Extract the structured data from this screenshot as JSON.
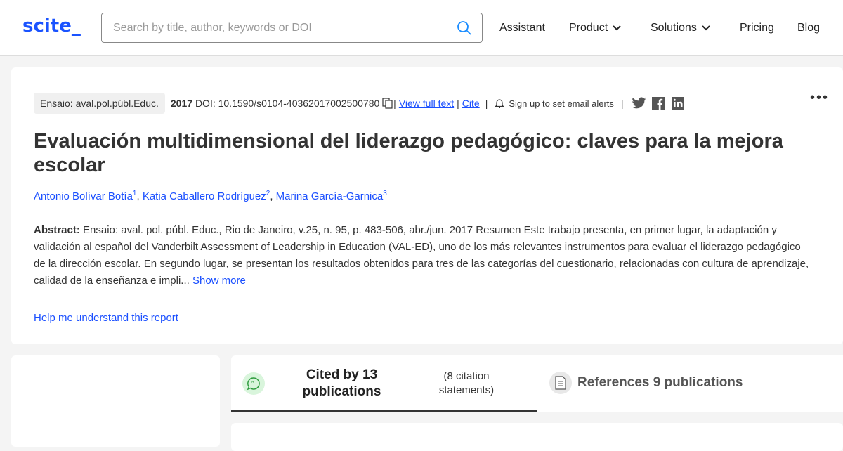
{
  "header": {
    "logo": "scite_",
    "search_placeholder": "Search by title, author, keywords or DOI",
    "nav": [
      {
        "label": "Assistant"
      },
      {
        "label": "Product",
        "dropdown": true
      },
      {
        "label": "Solutions",
        "dropdown": true
      },
      {
        "label": "Pricing"
      },
      {
        "label": "Blog"
      }
    ]
  },
  "paper": {
    "journal": "Ensaio: aval.pol.públ.Educ.",
    "year": "2017",
    "doi": "DOI: 10.1590/s0104-40362017002500780",
    "view_full_text": "View full text",
    "cite": "Cite",
    "alerts": "Sign up to set email alerts",
    "title": "Evaluación multidimensional del liderazgo pedagógico: claves para la mejora escolar",
    "authors": [
      {
        "name": "Antonio Bolívar Botía",
        "sup": "1"
      },
      {
        "name": "Katia Caballero Rodríguez",
        "sup": "2"
      },
      {
        "name": "Marina García-Garnica",
        "sup": "3"
      }
    ],
    "abstract_label": "Abstract:",
    "abstract": "Ensaio: aval. pol. públ. Educ., Rio de Janeiro, v.25, n. 95, p. 483-506, abr./jun. 2017 Resumen Este trabajo presenta, en primer lugar, la adaptación y validación al español del Vanderbilt Assessment of Leadership in Education (VAL-ED), uno de los más relevantes instrumentos para evaluar el liderazgo pedagógico de la dirección escolar. En segundo lugar, se presentan los resultados obtenidos para tres de las categorías del cuestionario, relacionadas con cultura de aprendizaje, calidad de la enseñanza e impli...",
    "show_more": "Show more",
    "help": "Help me understand this report",
    "more_menu": "•••"
  },
  "tabs": {
    "cited_by": "Cited by 13 publications",
    "citation_statements": "(8 citation statements)",
    "references": "References 9 publications"
  },
  "colors": {
    "brand": "#1a53ff",
    "link": "#1a4fff",
    "cited_icon_bg": "#d9f5dc"
  }
}
